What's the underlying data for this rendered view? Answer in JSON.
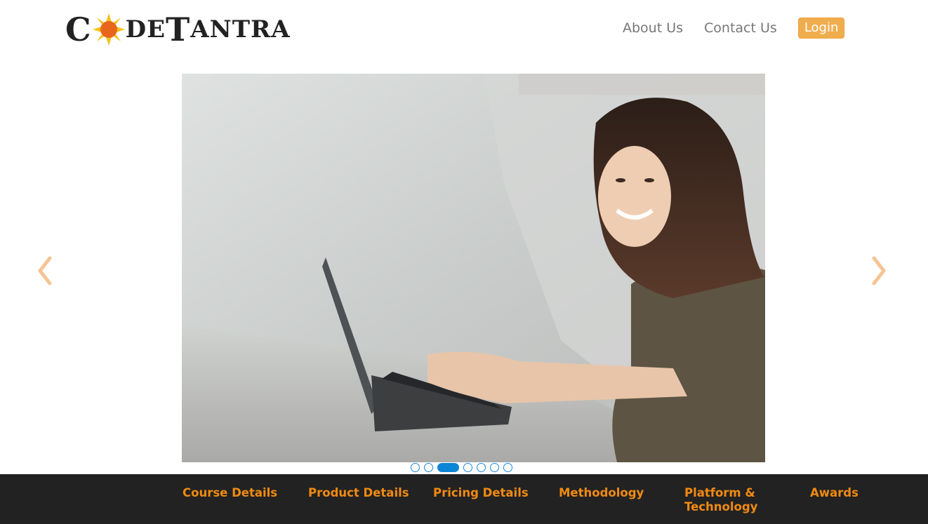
{
  "header": {
    "logo_text_pre": "C",
    "logo_text_post": "DE",
    "logo_text_t": "T",
    "logo_text_rest": "ANTRA",
    "nav": {
      "about": "About Us",
      "contact": "Contact Us",
      "login": "Login"
    }
  },
  "carousel": {
    "slide_count": 7,
    "active_index": 3,
    "prev_icon": "chevron-left-icon",
    "next_icon": "chevron-right-icon"
  },
  "footer": {
    "links": [
      "Course Details",
      "Product Details",
      "Pricing Details",
      "Methodology",
      "Platform &",
      "Technology",
      "Awards"
    ]
  },
  "colors": {
    "accent_orange": "#f0ad4e",
    "footer_bg": "#222222",
    "footer_link": "#f18a12",
    "indicator_blue": "#0b86d6"
  }
}
